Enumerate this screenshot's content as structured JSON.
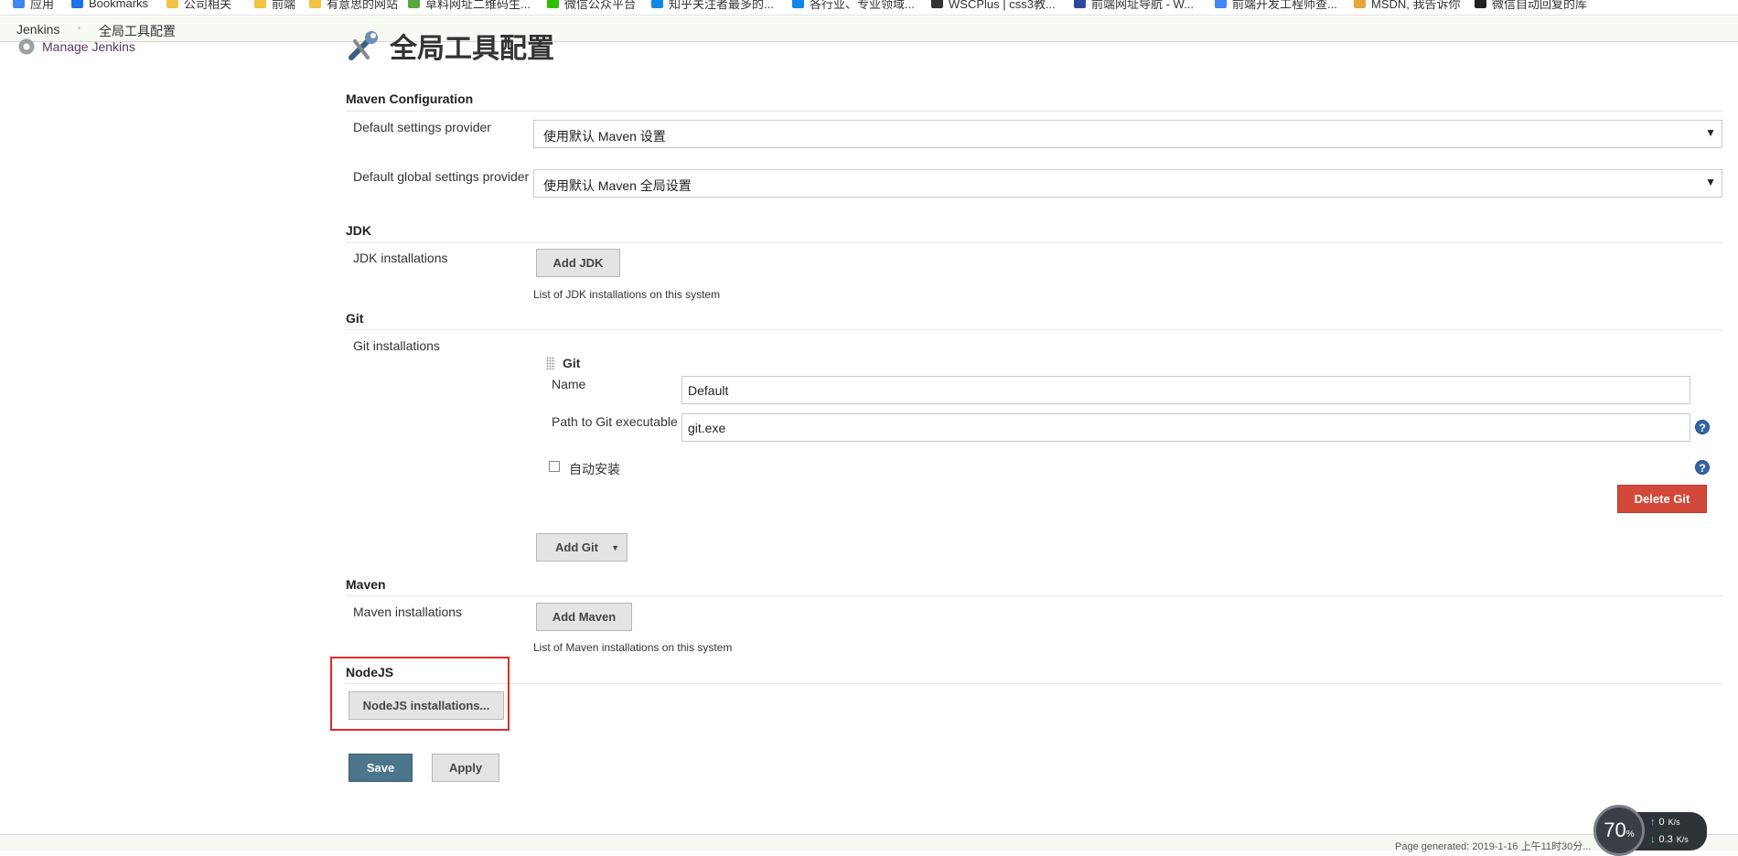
{
  "bookmarks": [
    {
      "label": "应用",
      "icon": "apps-grid-icon",
      "color": "#4285f4"
    },
    {
      "label": "Bookmarks",
      "icon": "star-icon",
      "color": "#1a73e8"
    },
    {
      "label": "公司相关",
      "icon": "folder-icon",
      "color": "#f3c443"
    },
    {
      "label": "前端",
      "icon": "folder-icon",
      "color": "#f3c443"
    },
    {
      "label": "有意思的网站",
      "icon": "folder-icon",
      "color": "#f3c443"
    },
    {
      "label": "草料网址二维码生...",
      "icon": "qrcode-icon",
      "color": "#58a83c"
    },
    {
      "label": "微信公众平台",
      "icon": "wechat-icon",
      "color": "#2dc100"
    },
    {
      "label": "知乎关注者最多的...",
      "icon": "zhihu-icon",
      "color": "#0f88eb"
    },
    {
      "label": "各行业、专业领域...",
      "icon": "zhihu-icon",
      "color": "#0f88eb"
    },
    {
      "label": "WSCPlus | css3教...",
      "icon": "site-icon",
      "color": "#333333"
    },
    {
      "label": "前端网址导航 - W...",
      "icon": "grid-icon",
      "color": "#2d4a9a"
    },
    {
      "label": "前端开发工程师查...",
      "icon": "google-icon",
      "color": "#4285f4"
    },
    {
      "label": "MSDN, 我告诉你",
      "icon": "msdn-icon",
      "color": "#e8a33c"
    },
    {
      "label": "微信自动回复的库",
      "icon": "github-icon",
      "color": "#222222"
    }
  ],
  "breadcrumb": {
    "root": "Jenkins",
    "separator": "›",
    "page": "全局工具配置"
  },
  "sidebar": {
    "manage_label": "Manage Jenkins"
  },
  "page": {
    "title": "全局工具配置"
  },
  "maven_config": {
    "heading": "Maven Configuration",
    "default_settings_label": "Default settings provider",
    "default_settings_value": "使用默认 Maven 设置",
    "global_settings_label": "Default global settings provider",
    "global_settings_value": "使用默认 Maven 全局设置",
    "caret": "▼"
  },
  "jdk": {
    "heading": "JDK",
    "installations_label": "JDK installations",
    "add_button": "Add JDK",
    "description": "List of JDK installations on this system"
  },
  "git": {
    "heading": "Git",
    "installations_label": "Git installations",
    "item_title": "Git",
    "name_label": "Name",
    "name_value": "Default",
    "path_label": "Path to Git executable",
    "path_value": "git.exe",
    "auto_install_label": "自动安装",
    "delete_button": "Delete Git",
    "add_button": "Add Git",
    "add_caret": "▼",
    "help_glyph": "?"
  },
  "maven": {
    "heading": "Maven",
    "installations_label": "Maven installations",
    "add_button": "Add Maven",
    "description": "List of Maven installations on this system"
  },
  "nodejs": {
    "heading": "NodeJS",
    "installations_button": "NodeJS installations...",
    "highlight_color": "#e12a2a"
  },
  "actions": {
    "save": "Save",
    "apply": "Apply"
  },
  "footer": {
    "text": "Page generated: 2019-1-16 上午11时30分..."
  },
  "speed_widget": {
    "percent": "70",
    "percent_unit": "%",
    "up": "0",
    "up_unit": "K/s",
    "down": "0.3",
    "down_unit": "K/s"
  }
}
